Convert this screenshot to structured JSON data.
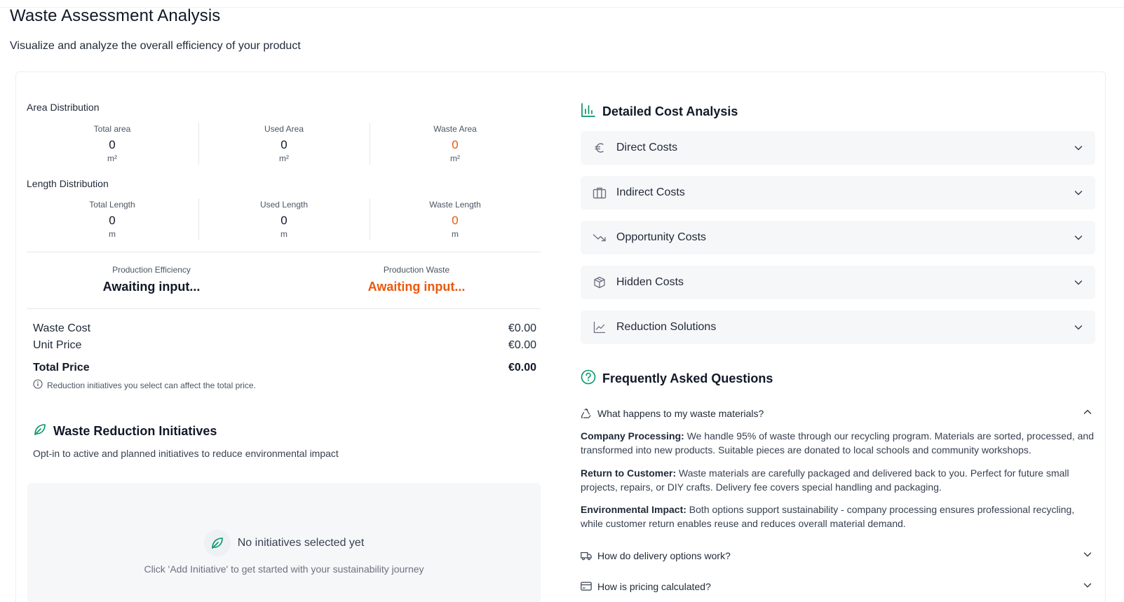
{
  "page": {
    "title": "Waste Assessment Analysis",
    "subtitle": "Visualize and analyze the overall efficiency of your product"
  },
  "area": {
    "label": "Area Distribution",
    "metrics": [
      {
        "label": "Total area",
        "value": "0",
        "unit": "m²"
      },
      {
        "label": "Used Area",
        "value": "0",
        "unit": "m²"
      },
      {
        "label": "Waste Area",
        "value": "0",
        "unit": "m²"
      }
    ]
  },
  "length": {
    "label": "Length Distribution",
    "metrics": [
      {
        "label": "Total Length",
        "value": "0",
        "unit": "m"
      },
      {
        "label": "Used Length",
        "value": "0",
        "unit": "m"
      },
      {
        "label": "Waste Length",
        "value": "0",
        "unit": "m"
      }
    ]
  },
  "production": {
    "efficiency_label": "Production Efficiency",
    "efficiency_value": "Awaiting input...",
    "waste_label": "Production Waste",
    "waste_value": "Awaiting input..."
  },
  "pricing": {
    "waste_cost_label": "Waste Cost",
    "waste_cost_value": "€0.00",
    "unit_price_label": "Unit Price",
    "unit_price_value": "€0.00",
    "total_label": "Total Price",
    "total_value": "€0.00",
    "note": "Reduction initiatives you select can affect the total price."
  },
  "initiatives": {
    "title": "Waste Reduction Initiatives",
    "subtitle": "Opt-in to active and planned initiatives to reduce environmental impact",
    "empty_title": "No initiatives selected yet",
    "empty_subtitle": "Click 'Add Initiative' to get started with your sustainability journey"
  },
  "cost_analysis": {
    "title": "Detailed Cost Analysis",
    "items": [
      {
        "label": "Direct Costs",
        "icon": "euro-icon"
      },
      {
        "label": "Indirect Costs",
        "icon": "briefcase-icon"
      },
      {
        "label": "Opportunity Costs",
        "icon": "trending-down-icon"
      },
      {
        "label": "Hidden Costs",
        "icon": "box-icon"
      },
      {
        "label": "Reduction Solutions",
        "icon": "line-chart-icon"
      }
    ]
  },
  "faq": {
    "title": "Frequently Asked Questions",
    "items": [
      {
        "question": "What happens to my waste materials?",
        "expanded": true,
        "answers": [
          {
            "bold": "Company Processing:",
            "text": " We handle 95% of waste through our recycling program. Materials are sorted, processed, and transformed into new products. Suitable pieces are donated to local schools and community workshops."
          },
          {
            "bold": "Return to Customer:",
            "text": " Waste materials are carefully packaged and delivered back to you. Perfect for future small projects, repairs, or DIY crafts. Delivery fee covers special handling and packaging."
          },
          {
            "bold": "Environmental Impact:",
            "text": " Both options support sustainability - company processing ensures professional recycling, while customer return enables reuse and reduces overall material demand."
          }
        ]
      },
      {
        "question": "How do delivery options work?",
        "expanded": false
      },
      {
        "question": "How is pricing calculated?",
        "expanded": false
      }
    ]
  },
  "colors": {
    "accent": "#059669",
    "waste": "#ea580c",
    "panel": "#f6f7f9"
  }
}
